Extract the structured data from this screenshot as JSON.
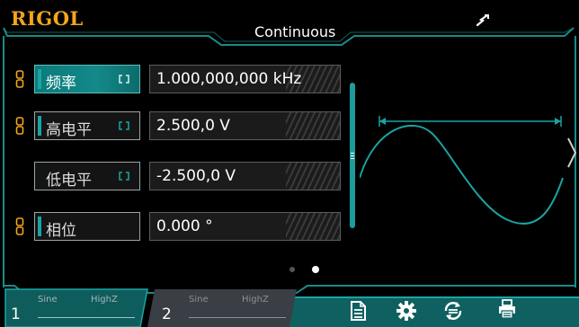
{
  "header": {
    "logo": "RIGOL",
    "mode": "Continuous"
  },
  "params": [
    {
      "label": "频率",
      "value": "1.000,000,000 kHz",
      "state": "active",
      "linked": true
    },
    {
      "label": "高电平",
      "value": "2.500,0 V",
      "state": "inactive",
      "linked": true
    },
    {
      "label": "低电平",
      "value": "-2.500,0 V",
      "state": "inactive",
      "linked": false
    },
    {
      "label": "相位",
      "value": "0.000 °",
      "state": "inactive",
      "linked": true
    }
  ],
  "channels": [
    {
      "num": "1",
      "wave": "Sine",
      "load": "HighZ"
    },
    {
      "num": "2",
      "wave": "Sine",
      "load": "HighZ"
    }
  ],
  "colors": {
    "accent": "#1aa3a3",
    "logo": "#f3a51c",
    "frame": "#1b8a8a"
  },
  "toolbar_icons": [
    "document-icon",
    "gear-icon",
    "sync-icon",
    "printer-icon"
  ]
}
